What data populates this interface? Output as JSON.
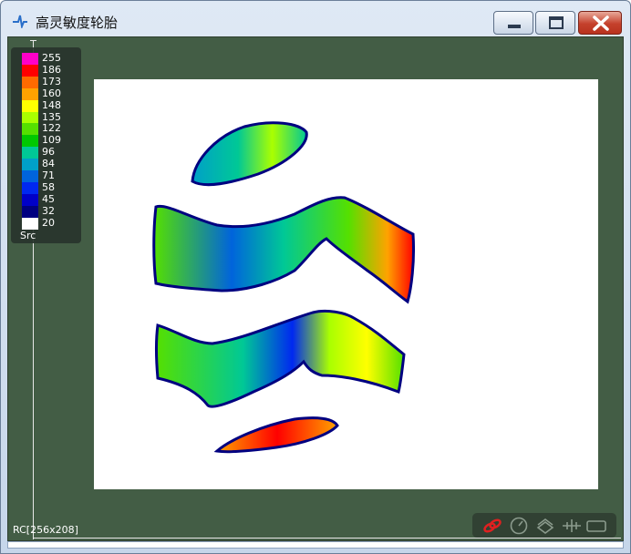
{
  "window": {
    "title": "高灵敏度轮胎"
  },
  "legend": {
    "entries": [
      {
        "label": "255",
        "color": "#ff00c8"
      },
      {
        "label": "186",
        "color": "#ff0000"
      },
      {
        "label": "173",
        "color": "#ff6a00"
      },
      {
        "label": "160",
        "color": "#ffa200"
      },
      {
        "label": "148",
        "color": "#ffff00"
      },
      {
        "label": "135",
        "color": "#aaff00"
      },
      {
        "label": "122",
        "color": "#55e000"
      },
      {
        "label": "109",
        "color": "#00c800"
      },
      {
        "label": "96",
        "color": "#00c896"
      },
      {
        "label": "84",
        "color": "#00a0c8"
      },
      {
        "label": "71",
        "color": "#0064dc"
      },
      {
        "label": "58",
        "color": "#0028f0"
      },
      {
        "label": "45",
        "color": "#0000c8"
      },
      {
        "label": "32",
        "color": "#000080"
      },
      {
        "label": "20",
        "color": "#ffffff"
      }
    ],
    "source_label": "Src"
  },
  "status": {
    "text": "RC[256x208]"
  },
  "toolbar": {
    "icons": [
      "link-icon",
      "compass-icon",
      "layers-icon",
      "signal-icon",
      "rectangle-icon"
    ]
  }
}
